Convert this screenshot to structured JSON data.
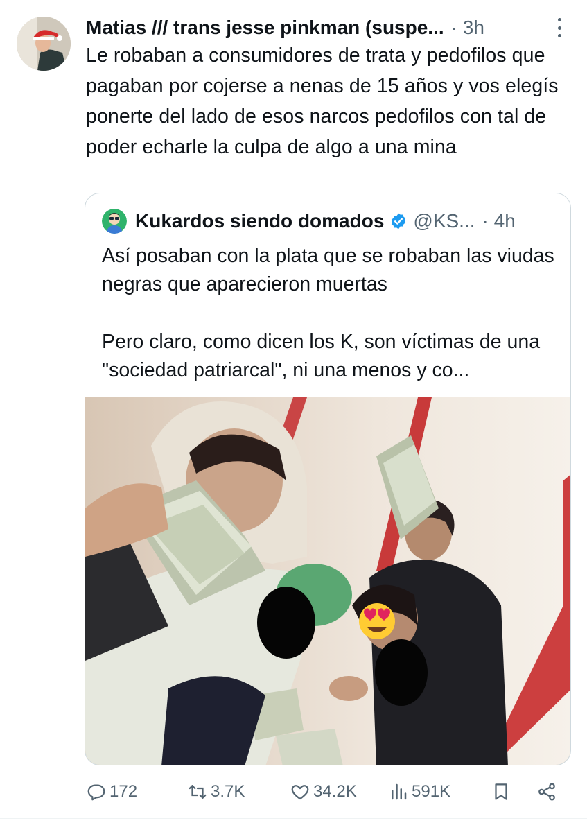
{
  "tweet": {
    "author_name": "Matias /// trans jesse pinkman (suspe...",
    "time": "· 3h",
    "avatar_icon": "user-avatar-santa-hat",
    "text": "Le robaban a consumidores de trata y pedofilos que pagaban por cojerse a nenas de 15 años y vos elegís ponerte del lado de esos narcos pedofilos con tal de poder echarle la culpa de algo a una mina"
  },
  "quote": {
    "author_name": "Kukardos siendo domados",
    "handle": "@KS...",
    "time": "· 4h",
    "verified": true,
    "avatar_icon": "cartoon-avatar-icon",
    "text_line1": "Así posaban con la plata que se robaban las viudas negras que aparecieron muertas",
    "text_line2": "Pero claro, como dicen los K, son víctimas de una \"sociedad patriarcal\", ni una menos y co...",
    "media_icon": "photo-group-with-money",
    "emoji_icon": "heart-eyes-emoji"
  },
  "actions": {
    "reply_count": "172",
    "retweet_count": "3.7K",
    "like_count": "34.2K",
    "views_count": "591K"
  },
  "colors": {
    "text_primary": "#0f1419",
    "text_secondary": "#536471",
    "border": "#cfd9de",
    "verified_blue": "#1d9bf0"
  }
}
